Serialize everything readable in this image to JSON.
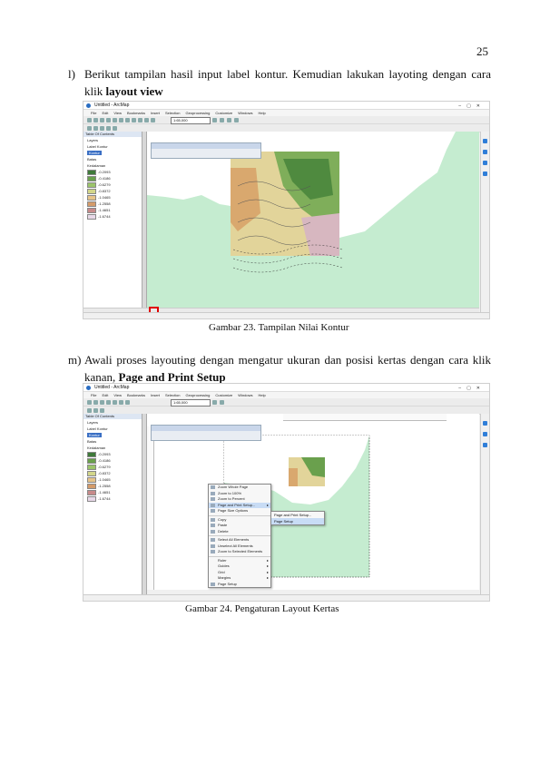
{
  "page": {
    "number": "25"
  },
  "item_l": {
    "label": "l)",
    "text_main": "Berikut tampilan hasil input label kontur. Kemudian lakukan layoting dengan cara klik ",
    "text_bold": "layout view"
  },
  "figure1": {
    "caption": "Gambar 23. Tampilan  Nilai Kontur",
    "window_title": "Untitled - ArcMap",
    "menu": [
      "File",
      "Edit",
      "View",
      "Bookmarks",
      "Insert",
      "Selection",
      "Geoprocessing",
      "Customize",
      "Windows",
      "Help"
    ],
    "scale": "1:65,000",
    "toc_title": "Table Of Contents",
    "toc_items": [
      "Layers",
      "Label Kontur",
      "Kontur",
      "Batas",
      "Kedalaman"
    ],
    "legend_values": [
      "-0.2093",
      "-0.4186",
      "-0.6279",
      "-0.8372",
      "-1.0465",
      "-1.2558",
      "-1.4651",
      "-1.6744"
    ],
    "colors": {
      "sea": "#c5ecd0",
      "land": "#ffffff",
      "highlight": "#e00000"
    }
  },
  "item_m": {
    "label": "m)",
    "text_main": "Awali proses layouting dengan mengatur ukuran dan posisi kertas dengan cara klik kanan, ",
    "text_bold": "Page and Print Setup"
  },
  "figure2": {
    "caption": "Gambar 24. Pengaturan Layout Kertas",
    "window_title": "Untitled - ArcMap",
    "scale": "1:65,000",
    "context_menu": [
      "Zoom Whole Page",
      "Zoom to 100%",
      "Zoom to Percent",
      "Page and Print Setup...",
      "Page Size Options",
      "Copy",
      "Paste",
      "Delete",
      "Select All Elements",
      "Unselect All Elements",
      "Zoom to Selected Elements",
      "Ruler",
      "Guides",
      "Grid",
      "Margins",
      "Page Setup"
    ],
    "submenu": [
      "Page and Print Setup...",
      "Page Setup"
    ]
  }
}
